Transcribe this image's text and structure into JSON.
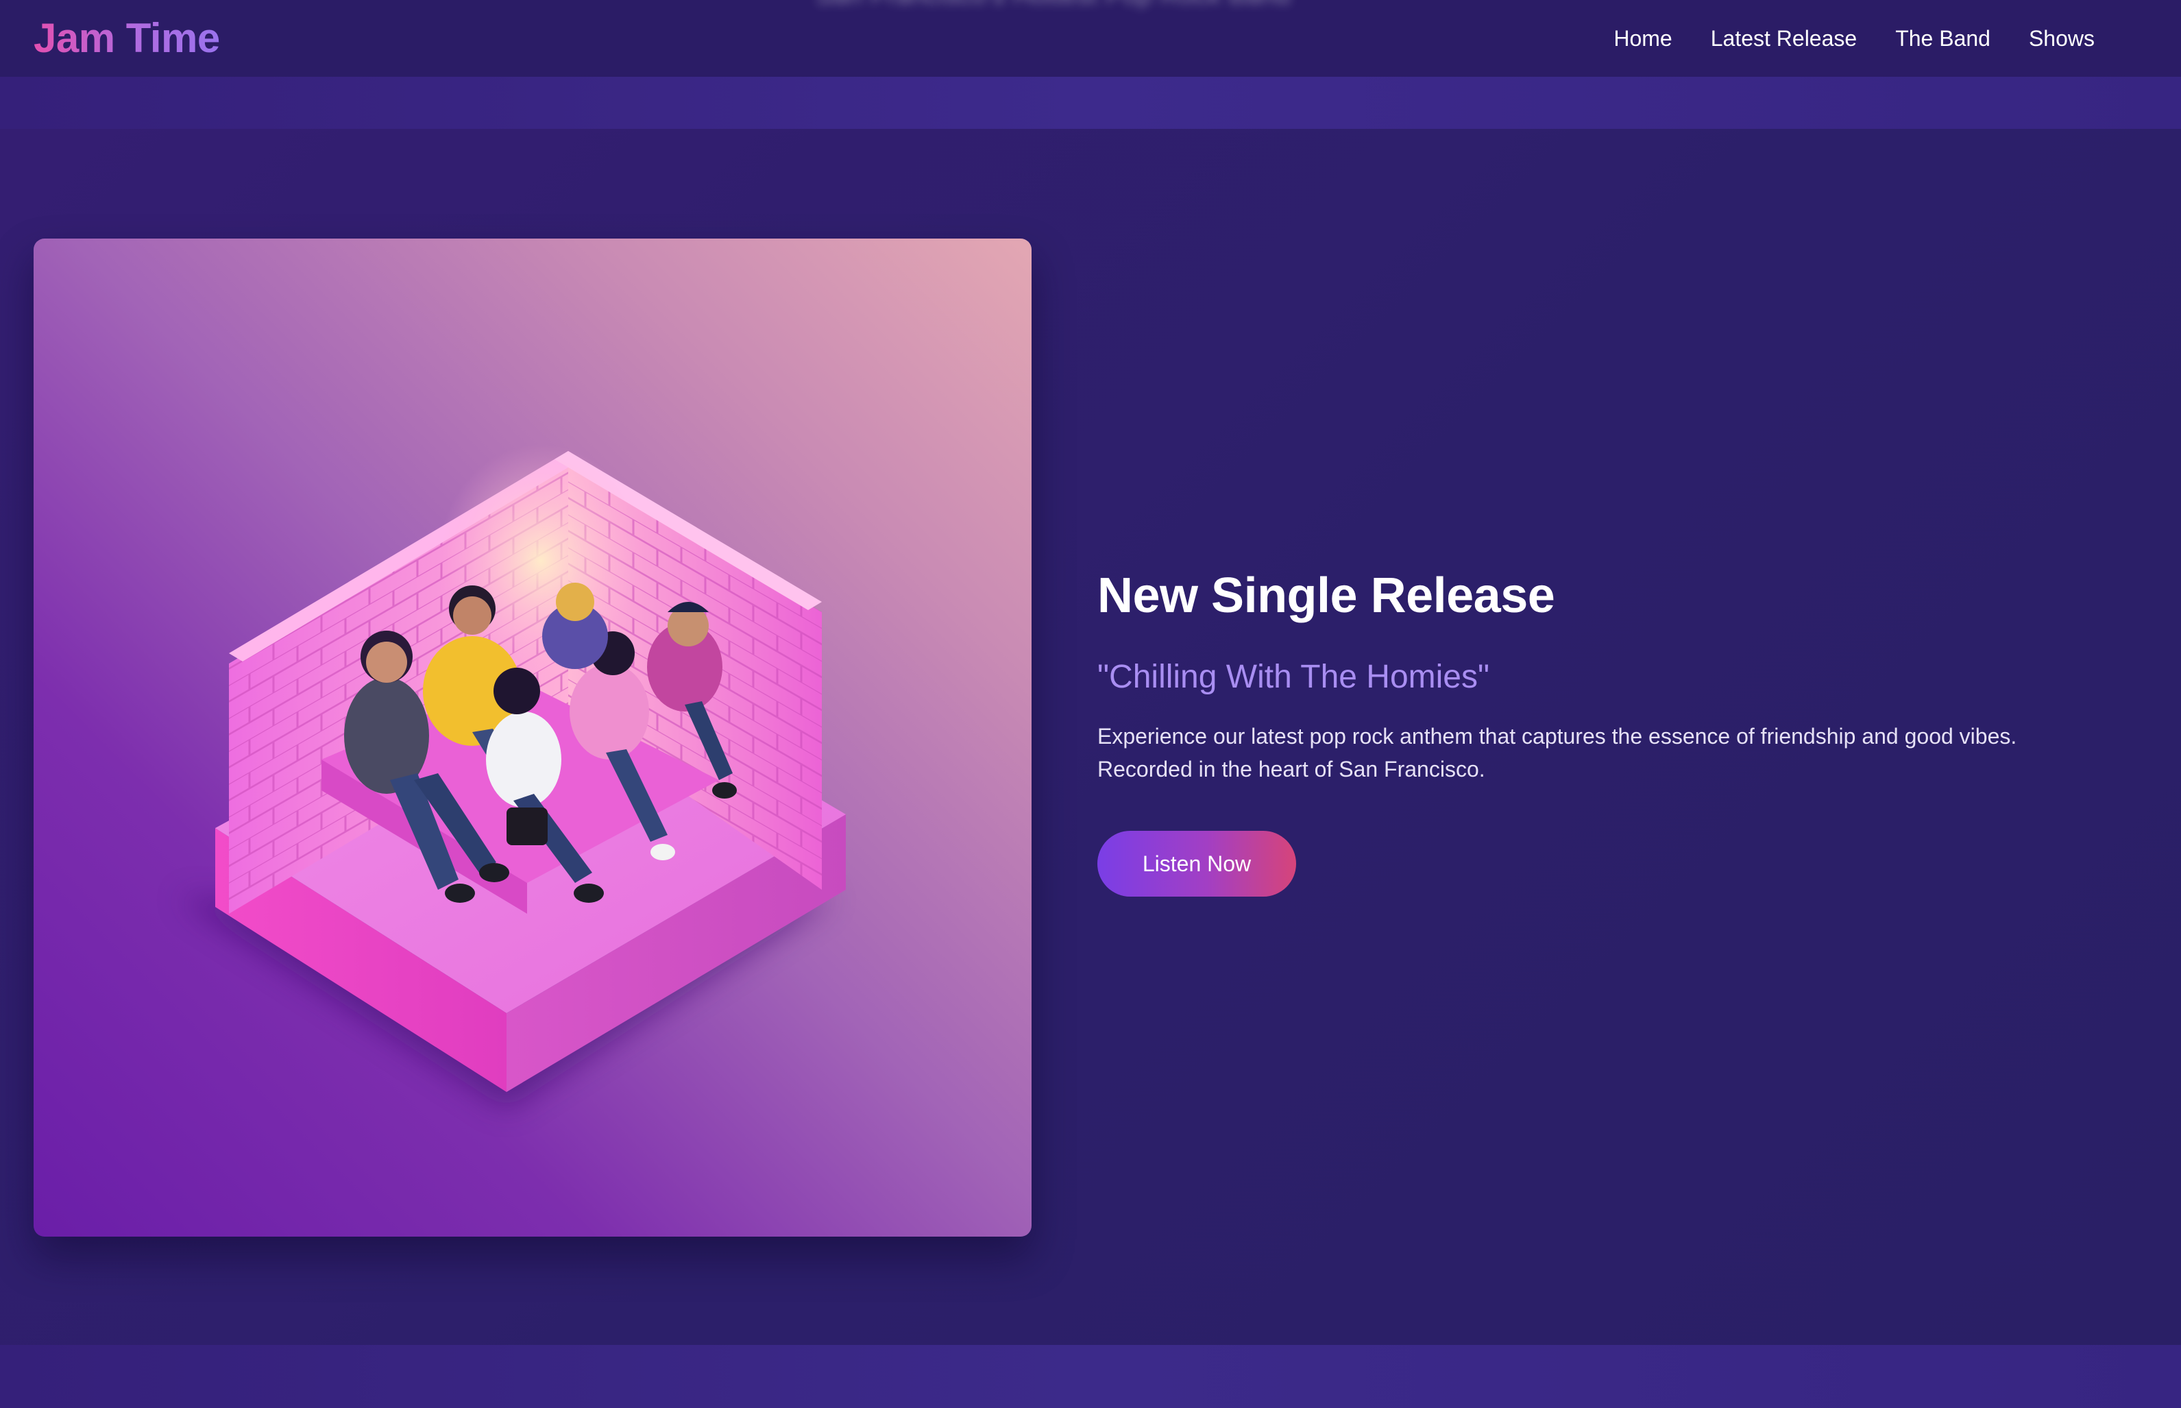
{
  "header": {
    "logo": "Jam Time",
    "tagline": "San Francisco's Hottest Pop Rock Band",
    "nav": [
      {
        "label": "Home"
      },
      {
        "label": "Latest Release"
      },
      {
        "label": "The Band"
      },
      {
        "label": "Shows"
      }
    ]
  },
  "hero": {
    "headline": "New Single Release",
    "song_title": "\"Chilling With The Homies\"",
    "description": "Experience our latest pop rock anthem that captures the essence of friendship and good vibes. Recorded in the heart of San Francisco.",
    "cta_label": "Listen Now"
  },
  "colors": {
    "background": "#2d1e6b",
    "nav_background": "#2b1c66",
    "accent_purple": "#a98ef2",
    "cta_gradient_start": "#7a3ee6",
    "cta_gradient_end": "#d6447a",
    "logo_gradient_start": "#e250b1",
    "logo_gradient_end": "#9a73ee"
  }
}
